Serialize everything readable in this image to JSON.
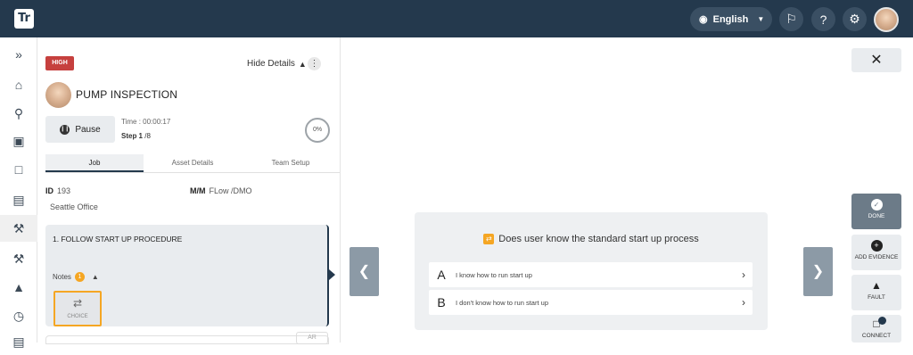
{
  "header": {
    "logo": "Tr",
    "language": "English"
  },
  "sidebar": {
    "items": [
      "expand",
      "home",
      "location",
      "assets",
      "inventory",
      "documents",
      "tools",
      "maintenance",
      "alerts",
      "clock",
      "more"
    ]
  },
  "panel": {
    "priority": "HIGH",
    "hide_details": "Hide Details",
    "title": "PUMP INSPECTION",
    "pause_label": "Pause",
    "time": "Time : 00:00:17",
    "step_label": "Step 1",
    "step_total": " /8",
    "progress": "0%",
    "tabs": [
      "Job",
      "Asset Details",
      "Team Setup"
    ],
    "id_label": "ID",
    "id_value": "193",
    "mm_label": "M/M",
    "mm_value": "FLow /DMO",
    "office": "Seattle Office",
    "step_card": {
      "title": "1.   FOLLOW START UP PROCEDURE",
      "notes_label": "Notes",
      "notes_count": "1",
      "choice_label": "CHOICE"
    },
    "ar_label": "AR"
  },
  "question": {
    "title": "Does user know the standard start up process",
    "options": [
      {
        "letter": "A",
        "text": "I know how to run start up"
      },
      {
        "letter": "B",
        "text": "I don't know how to run start up"
      }
    ]
  },
  "actions": {
    "close": "✕",
    "done": "DONE",
    "add_evidence": "ADD EVIDENCE",
    "fault": "FAULT",
    "connect": "CONNECT"
  },
  "colors": {
    "topbar": "#24394d",
    "high_badge": "#c6403e",
    "accent": "#f5a623",
    "done_btn": "#6c7b88"
  }
}
